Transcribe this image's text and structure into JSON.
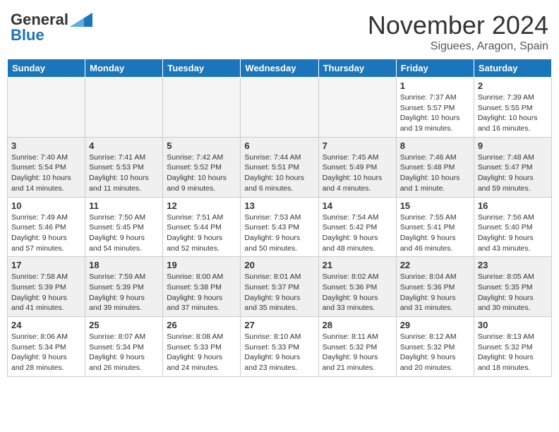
{
  "header": {
    "logo_general": "General",
    "logo_blue": "Blue",
    "month_year": "November 2024",
    "location": "Siguees, Aragon, Spain"
  },
  "days_of_week": [
    "Sunday",
    "Monday",
    "Tuesday",
    "Wednesday",
    "Thursday",
    "Friday",
    "Saturday"
  ],
  "weeks": [
    [
      {
        "day": "",
        "info": ""
      },
      {
        "day": "",
        "info": ""
      },
      {
        "day": "",
        "info": ""
      },
      {
        "day": "",
        "info": ""
      },
      {
        "day": "",
        "info": ""
      },
      {
        "day": "1",
        "info": "Sunrise: 7:37 AM\nSunset: 5:57 PM\nDaylight: 10 hours and 19 minutes."
      },
      {
        "day": "2",
        "info": "Sunrise: 7:39 AM\nSunset: 5:55 PM\nDaylight: 10 hours and 16 minutes."
      }
    ],
    [
      {
        "day": "3",
        "info": "Sunrise: 7:40 AM\nSunset: 5:54 PM\nDaylight: 10 hours and 14 minutes."
      },
      {
        "day": "4",
        "info": "Sunrise: 7:41 AM\nSunset: 5:53 PM\nDaylight: 10 hours and 11 minutes."
      },
      {
        "day": "5",
        "info": "Sunrise: 7:42 AM\nSunset: 5:52 PM\nDaylight: 10 hours and 9 minutes."
      },
      {
        "day": "6",
        "info": "Sunrise: 7:44 AM\nSunset: 5:51 PM\nDaylight: 10 hours and 6 minutes."
      },
      {
        "day": "7",
        "info": "Sunrise: 7:45 AM\nSunset: 5:49 PM\nDaylight: 10 hours and 4 minutes."
      },
      {
        "day": "8",
        "info": "Sunrise: 7:46 AM\nSunset: 5:48 PM\nDaylight: 10 hours and 1 minute."
      },
      {
        "day": "9",
        "info": "Sunrise: 7:48 AM\nSunset: 5:47 PM\nDaylight: 9 hours and 59 minutes."
      }
    ],
    [
      {
        "day": "10",
        "info": "Sunrise: 7:49 AM\nSunset: 5:46 PM\nDaylight: 9 hours and 57 minutes."
      },
      {
        "day": "11",
        "info": "Sunrise: 7:50 AM\nSunset: 5:45 PM\nDaylight: 9 hours and 54 minutes."
      },
      {
        "day": "12",
        "info": "Sunrise: 7:51 AM\nSunset: 5:44 PM\nDaylight: 9 hours and 52 minutes."
      },
      {
        "day": "13",
        "info": "Sunrise: 7:53 AM\nSunset: 5:43 PM\nDaylight: 9 hours and 50 minutes."
      },
      {
        "day": "14",
        "info": "Sunrise: 7:54 AM\nSunset: 5:42 PM\nDaylight: 9 hours and 48 minutes."
      },
      {
        "day": "15",
        "info": "Sunrise: 7:55 AM\nSunset: 5:41 PM\nDaylight: 9 hours and 46 minutes."
      },
      {
        "day": "16",
        "info": "Sunrise: 7:56 AM\nSunset: 5:40 PM\nDaylight: 9 hours and 43 minutes."
      }
    ],
    [
      {
        "day": "17",
        "info": "Sunrise: 7:58 AM\nSunset: 5:39 PM\nDaylight: 9 hours and 41 minutes."
      },
      {
        "day": "18",
        "info": "Sunrise: 7:59 AM\nSunset: 5:39 PM\nDaylight: 9 hours and 39 minutes."
      },
      {
        "day": "19",
        "info": "Sunrise: 8:00 AM\nSunset: 5:38 PM\nDaylight: 9 hours and 37 minutes."
      },
      {
        "day": "20",
        "info": "Sunrise: 8:01 AM\nSunset: 5:37 PM\nDaylight: 9 hours and 35 minutes."
      },
      {
        "day": "21",
        "info": "Sunrise: 8:02 AM\nSunset: 5:36 PM\nDaylight: 9 hours and 33 minutes."
      },
      {
        "day": "22",
        "info": "Sunrise: 8:04 AM\nSunset: 5:36 PM\nDaylight: 9 hours and 31 minutes."
      },
      {
        "day": "23",
        "info": "Sunrise: 8:05 AM\nSunset: 5:35 PM\nDaylight: 9 hours and 30 minutes."
      }
    ],
    [
      {
        "day": "24",
        "info": "Sunrise: 8:06 AM\nSunset: 5:34 PM\nDaylight: 9 hours and 28 minutes."
      },
      {
        "day": "25",
        "info": "Sunrise: 8:07 AM\nSunset: 5:34 PM\nDaylight: 9 hours and 26 minutes."
      },
      {
        "day": "26",
        "info": "Sunrise: 8:08 AM\nSunset: 5:33 PM\nDaylight: 9 hours and 24 minutes."
      },
      {
        "day": "27",
        "info": "Sunrise: 8:10 AM\nSunset: 5:33 PM\nDaylight: 9 hours and 23 minutes."
      },
      {
        "day": "28",
        "info": "Sunrise: 8:11 AM\nSunset: 5:32 PM\nDaylight: 9 hours and 21 minutes."
      },
      {
        "day": "29",
        "info": "Sunrise: 8:12 AM\nSunset: 5:32 PM\nDaylight: 9 hours and 20 minutes."
      },
      {
        "day": "30",
        "info": "Sunrise: 8:13 AM\nSunset: 5:32 PM\nDaylight: 9 hours and 18 minutes."
      }
    ]
  ]
}
